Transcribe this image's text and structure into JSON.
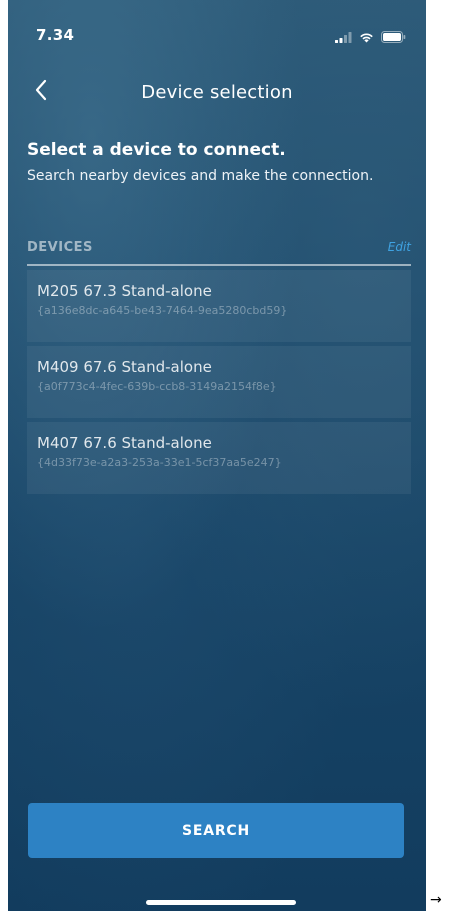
{
  "status_bar": {
    "time": "7.34",
    "icons": [
      "signal-icon",
      "wifi-icon",
      "battery-icon"
    ]
  },
  "nav": {
    "back_icon": "chevron-left-icon",
    "title": "Device selection"
  },
  "intro": {
    "heading": "Select a device to connect.",
    "text": "Search nearby devices and make the connection."
  },
  "devices_section": {
    "title": "DEVICES",
    "edit_label": "Edit",
    "items": [
      {
        "name": "M205 67.3 Stand-alone",
        "id": "{a136e8dc-a645-be43-7464-9ea5280cbd59}"
      },
      {
        "name": "M409 67.6 Stand-alone",
        "id": "{a0f773c4-4fec-639b-ccb8-3149a2154f8e}"
      },
      {
        "name": "M407 67.6 Stand-alone",
        "id": "{4d33f73e-a2a3-253a-33e1-5cf37aa5e247}"
      }
    ]
  },
  "search_button": {
    "label": "SEARCH"
  },
  "edge_glyph": "→",
  "colors": {
    "accent": "#2d82c4",
    "edit_link": "#3fa3e2",
    "background_top": "#2c5a78",
    "background_bottom": "#123c5e"
  }
}
